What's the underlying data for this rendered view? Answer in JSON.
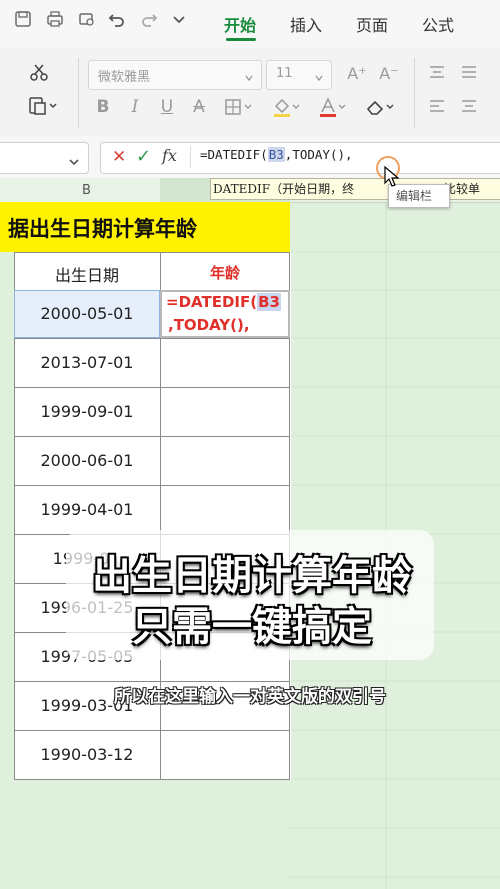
{
  "toolbar": {
    "tabs": [
      {
        "label": "开始",
        "active": true
      },
      {
        "label": "插入",
        "active": false
      },
      {
        "label": "页面",
        "active": false
      },
      {
        "label": "公式",
        "active": false
      }
    ],
    "icons": [
      "save-icon",
      "print-icon",
      "print-preview-icon",
      "undo-icon",
      "redo-icon",
      "chevron-down-icon"
    ]
  },
  "ribbon": {
    "font_name": "微软雅黑",
    "font_size": "11",
    "buttons": {
      "bold": "B",
      "italic": "I",
      "underline": "U",
      "strike": "A",
      "grow_font": "A⁺",
      "shrink_font": "A⁻"
    }
  },
  "formula_bar": {
    "cancel": "✕",
    "confirm": "✓",
    "fx": "fx",
    "formula_prefix": "=DATEDIF(",
    "formula_ref": "B3",
    "formula_suffix": ",TODAY(),"
  },
  "tooltip": {
    "text": "DATEDIF（开始日期，终",
    "text_tail": "比较单",
    "bubble": "编辑栏"
  },
  "sheet": {
    "col_header": "B",
    "title": "据出生日期计算年龄",
    "headers": {
      "birth": "出生日期",
      "age": "年龄"
    },
    "editing_cell": {
      "line1_prefix": "=DATEDIF(",
      "line1_ref": "B3",
      "line2": ",TODAY(),"
    },
    "rows": [
      "2000-05-01",
      "2013-07-01",
      "1999-09-01",
      "2000-06-01",
      "1999-04-01",
      "1999-0",
      "1996-01-25",
      "1997-05-05",
      "1999-03-01",
      "1990-03-12"
    ]
  },
  "overlay": {
    "line1": "出生日期计算年龄",
    "line2": "只需一键搞定",
    "subtitle": "所以在这里输入一对英文版的双引号"
  },
  "colors": {
    "accent": "#1a8a3c",
    "formula_red": "#e0302a",
    "sheet_bg": "#dff0dc",
    "title_bg": "#fff200"
  }
}
